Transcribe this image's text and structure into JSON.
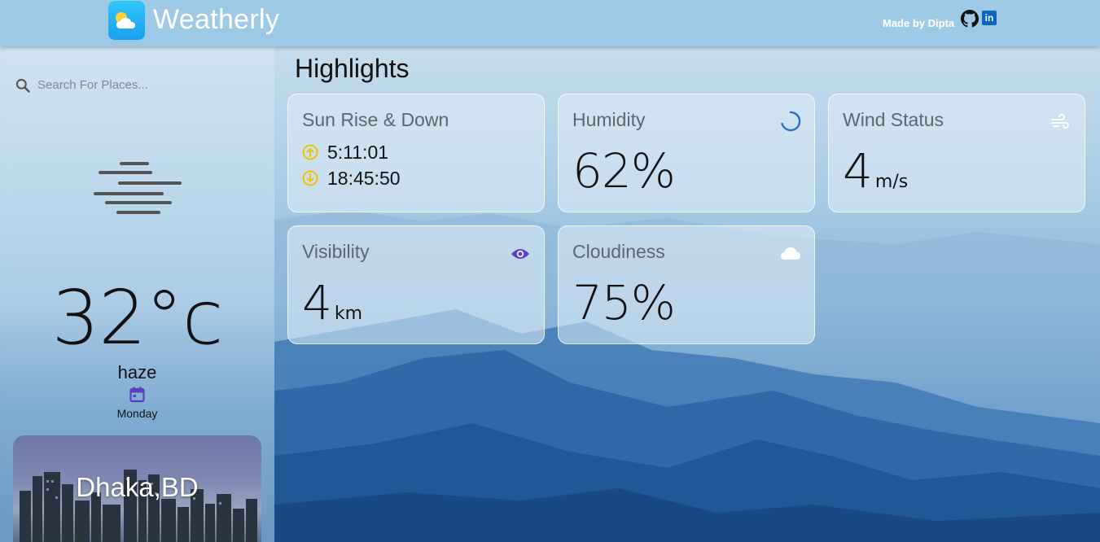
{
  "app": {
    "title": "Weatherly",
    "made_by": "Made by Dipta"
  },
  "icons": {
    "logo": "weather-logo-icon",
    "github": "github-icon",
    "linkedin": "linkedin-icon",
    "linkedin_text": "in",
    "search": "search-icon",
    "haze": "haze-icon",
    "calendar": "calendar-icon"
  },
  "search": {
    "placeholder": "Search For Places..."
  },
  "current": {
    "temperature": "32°c",
    "condition": "haze",
    "day": "Monday",
    "city": "Dhaka,BD"
  },
  "highlights": {
    "title": "Highlights",
    "sun": {
      "title": "Sun Rise & Down",
      "sunrise": "5:11:01",
      "sunset": "18:45:50"
    },
    "humidity": {
      "title": "Humidity",
      "value": "62%"
    },
    "wind": {
      "title": "Wind Status",
      "value": "4",
      "unit": "m/s"
    },
    "visibility": {
      "title": "Visibility",
      "value": "4",
      "unit": "km"
    },
    "cloudiness": {
      "title": "Cloudiness",
      "value": "75%"
    }
  },
  "colors": {
    "sun_icon": "#f2c200",
    "eye_icon": "#5a3fc0",
    "calendar_icon": "#5a3fc0",
    "humidity_spinner": "#2a6fc8",
    "logo_bg": "#1aa0f0"
  }
}
